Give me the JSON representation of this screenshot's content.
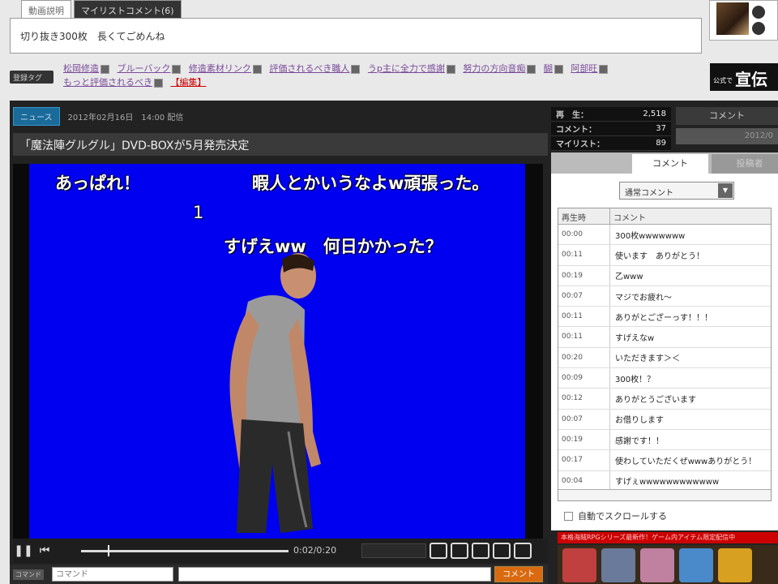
{
  "description_tabs": [
    {
      "label": "動画説明"
    },
    {
      "label": "マイリストコメント(6)"
    }
  ],
  "description_text": "切り抜き300枚　長くてごめんね",
  "tag_label": "登録タグ",
  "tags": [
    {
      "label": "松岡修造"
    },
    {
      "label": "ブルーバック"
    },
    {
      "label": "修造素材リンク"
    },
    {
      "label": "評価されるべき職人"
    },
    {
      "label": "うp主に全力で感謝"
    },
    {
      "label": "努力の方向音痴"
    },
    {
      "label": "醐"
    },
    {
      "label": "阿部旺"
    },
    {
      "label": "もっと評価されるべき"
    }
  ],
  "tag_edit_label": "【編集】",
  "ad_banner": {
    "small": "公式で",
    "big": "宣伝"
  },
  "news": {
    "badge": "ニュース",
    "date": "2012年02月16日　14:00 配信",
    "title": "「魔法陣グルグル」DVD-BOXが5月発売決定"
  },
  "danmaku": [
    {
      "text": "あっぱれ！"
    },
    {
      "text": "暇人とかいうなよw頑張った。"
    },
    {
      "text": "1"
    },
    {
      "text": "すげえww　何日かかった？"
    }
  ],
  "player": {
    "time": "0:02/0:20",
    "seek_fraction": 0.13
  },
  "command_bar": {
    "label": "コマンド",
    "placeholder": "コマンド",
    "submit": "コメント"
  },
  "stats": [
    {
      "label": "再　生：",
      "value": "2,518"
    },
    {
      "label": "コメント：",
      "value": "37"
    },
    {
      "label": "マイリスト：",
      "value": "89"
    }
  ],
  "right_top_tab": "コメント",
  "right_second_tab": "2012/0",
  "panel_tabs": [
    {
      "label": "コメント"
    },
    {
      "label": "投稿者"
    }
  ],
  "comment_filter": "通常コメント",
  "comment_headers": {
    "time": "再生時",
    "comment": "コメント"
  },
  "comments": [
    {
      "time": "00:00",
      "text": "300枚wwwwwww"
    },
    {
      "time": "00:11",
      "text": "使います　ありがとう！"
    },
    {
      "time": "00:19",
      "text": "乙www"
    },
    {
      "time": "00:07",
      "text": "マジでお疲れ〜"
    },
    {
      "time": "00:11",
      "text": "ありがとござーっす！！！"
    },
    {
      "time": "00:11",
      "text": "すげえなw"
    },
    {
      "time": "00:20",
      "text": "いただきます＞＜"
    },
    {
      "time": "00:09",
      "text": "300枚！？"
    },
    {
      "time": "00:12",
      "text": "ありがとうございます"
    },
    {
      "time": "00:07",
      "text": "お借りします"
    },
    {
      "time": "00:19",
      "text": "感謝です！！"
    },
    {
      "time": "00:17",
      "text": "使わしていただくぜwwwありがとう！"
    },
    {
      "time": "00:04",
      "text": "すげぇwwwwwwwwwwww"
    }
  ],
  "autoscroll_label": "自動でスクロールする",
  "red_banner": "本格海賊RPGシリーズ最新作！ゲーム内アイテム限定配信中"
}
